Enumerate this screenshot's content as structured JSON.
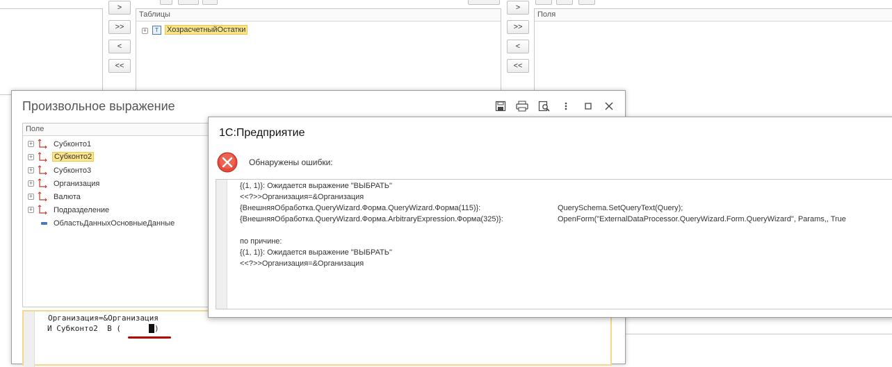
{
  "top": {
    "left_buttons": [
      ">",
      ">>",
      "<",
      "<<"
    ],
    "right_buttons": [
      ">",
      ">>",
      "<",
      "<<"
    ],
    "tables_panel": {
      "header": "Таблицы",
      "items": [
        "ХозрасчетныйОстатки"
      ]
    },
    "fields_panel": {
      "header": "Поля"
    }
  },
  "expr_window": {
    "title": "Произвольное выражение",
    "field_panel_header": "Поле",
    "fields": [
      {
        "label": "Субконто1",
        "expandable": true
      },
      {
        "label": "Субконто2",
        "expandable": true,
        "selected": true
      },
      {
        "label": "Субконто3",
        "expandable": true
      },
      {
        "label": "Организация",
        "expandable": true
      },
      {
        "label": "Валюта",
        "expandable": true
      },
      {
        "label": "Подразделение",
        "expandable": true
      },
      {
        "label": "ОбластьДанныхОсновныеДанные",
        "expandable": false
      }
    ],
    "editor_lines": [
      "Организация=&Организация",
      "И Субконто2  В ( "
    ]
  },
  "error_dialog": {
    "title": "1С:Предприятие",
    "message": "Обнаружены ошибки:",
    "details": [
      {
        "a": "{(1, 1)}: Ожидается выражение \"ВЫБРАТЬ\"",
        "b": ""
      },
      {
        "a": "<<?>>Организация=&Организация",
        "b": ""
      },
      {
        "a": "{ВнешняяОбработка.QueryWizard.Форма.QueryWizard.Форма(115)}:",
        "b": "QuerySchema.SetQueryText(Query);"
      },
      {
        "a": "{ВнешняяОбработка.QueryWizard.Форма.ArbitraryExpression.Форма(325)}:",
        "b": "OpenForm(\"ExternalDataProcessor.QueryWizard.Form.QueryWizard\", Params,, True"
      },
      {
        "a": "",
        "b": ""
      },
      {
        "a": "по причине:",
        "b": ""
      },
      {
        "a": "{(1, 1)}: Ожидается выражение \"ВЫБРАТЬ\"",
        "b": ""
      },
      {
        "a": "<<?>>Организация=&Организация",
        "b": ""
      }
    ]
  },
  "colors": {
    "selection": "#fbe58a",
    "error_icon": "#e64a3b",
    "underline": "#b00000"
  }
}
